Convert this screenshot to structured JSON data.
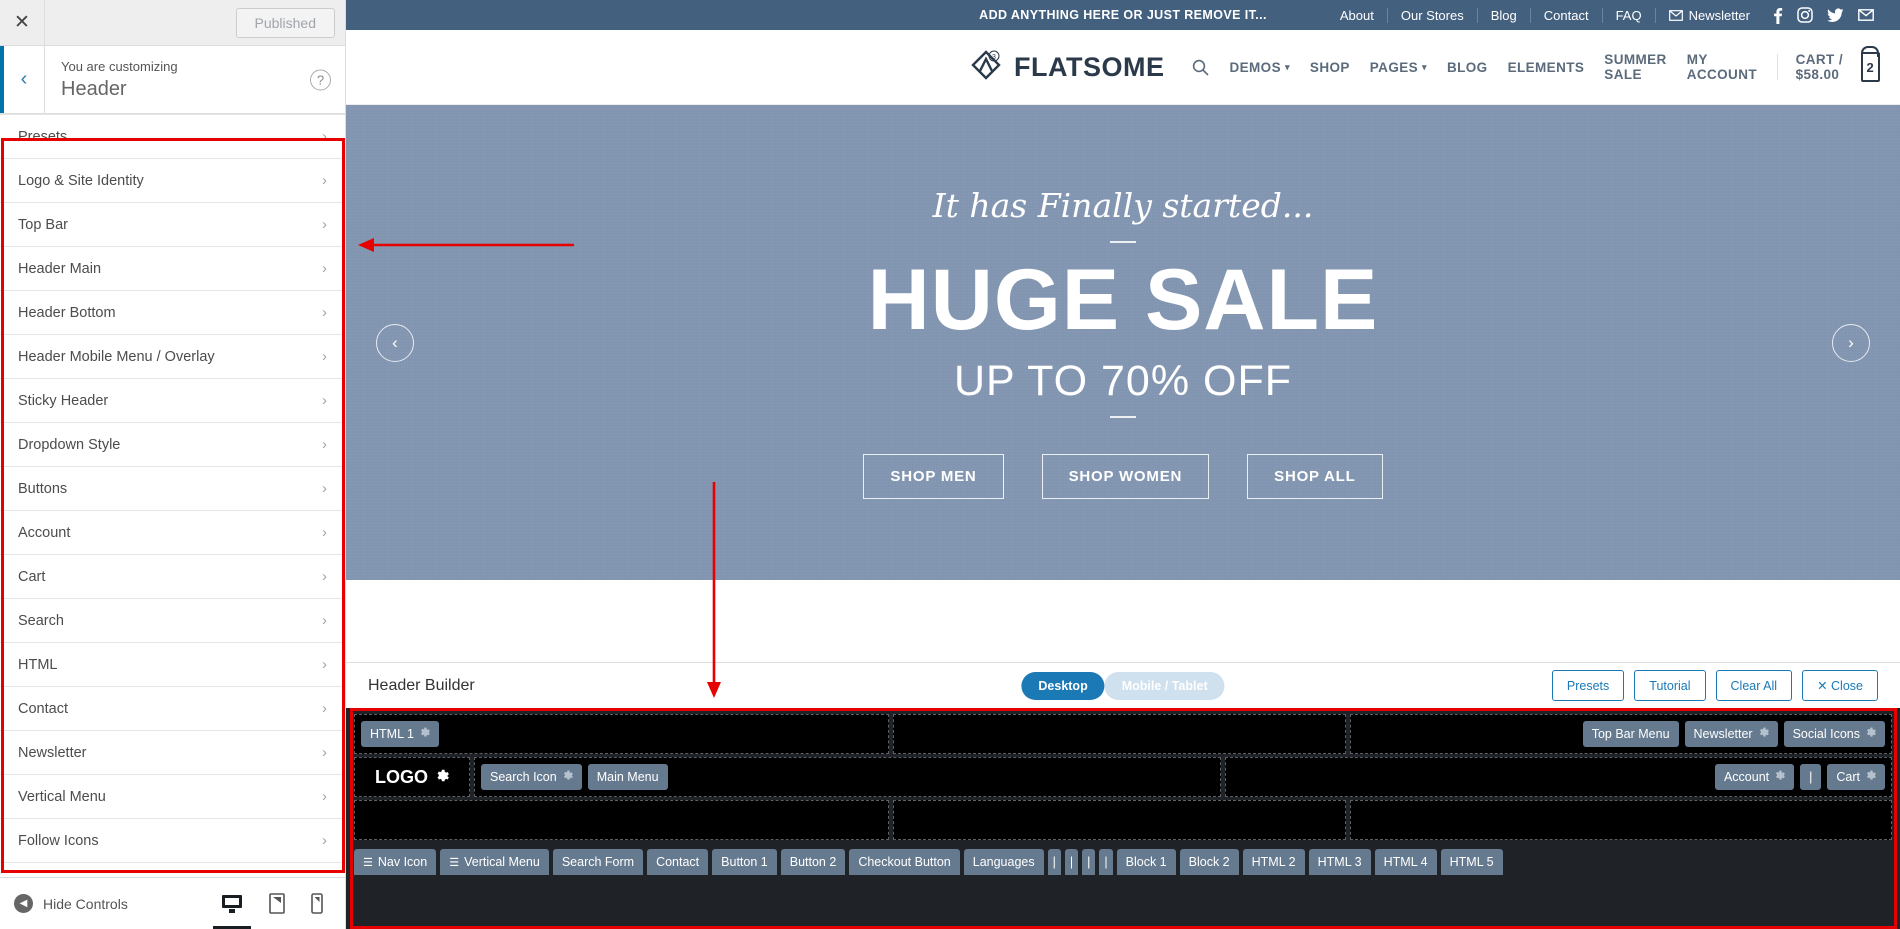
{
  "customizer": {
    "close_icon": "close-icon",
    "publish_label": "Published",
    "back_icon": "chevron-left-icon",
    "you_are_customizing": "You are customizing",
    "panel_title": "Header",
    "help_label": "?",
    "items": [
      {
        "label": "Presets"
      },
      {
        "label": "Logo & Site Identity"
      },
      {
        "label": "Top Bar"
      },
      {
        "label": "Header Main"
      },
      {
        "label": "Header Bottom"
      },
      {
        "label": "Header Mobile Menu / Overlay"
      },
      {
        "label": "Sticky Header"
      },
      {
        "label": "Dropdown Style"
      },
      {
        "label": "Buttons"
      },
      {
        "label": "Account"
      },
      {
        "label": "Cart"
      },
      {
        "label": "Search"
      },
      {
        "label": "HTML"
      },
      {
        "label": "Contact"
      },
      {
        "label": "Newsletter"
      },
      {
        "label": "Vertical Menu"
      },
      {
        "label": "Follow Icons"
      }
    ],
    "footer": {
      "hide_controls": "Hide Controls",
      "devices": [
        "desktop-icon",
        "tablet-icon",
        "mobile-icon"
      ],
      "active_device": "desktop-icon"
    }
  },
  "site": {
    "topbar": {
      "message": "ADD ANYTHING HERE OR JUST REMOVE IT...",
      "links": [
        "About",
        "Our Stores",
        "Blog",
        "Contact",
        "FAQ"
      ],
      "newsletter": "Newsletter",
      "newsletter_icon": "envelope-icon",
      "social": [
        "facebook-icon",
        "instagram-icon",
        "twitter-icon",
        "envelope-icon"
      ],
      "bg_color": "#44607f"
    },
    "header": {
      "logo_text": "FLATSOME",
      "logo_icon": "flatsome-diamond-logo",
      "search_icon": "search-icon",
      "nav": [
        {
          "label": "DEMOS",
          "caret": true
        },
        {
          "label": "SHOP",
          "caret": false
        },
        {
          "label": "PAGES",
          "caret": true
        },
        {
          "label": "BLOG",
          "caret": false
        },
        {
          "label": "ELEMENTS",
          "caret": false
        },
        {
          "label": "SUMMER SALE",
          "caret": false
        }
      ],
      "my_account": "MY ACCOUNT",
      "cart_label": "CART / $58.00",
      "cart_count": "2"
    },
    "hero": {
      "script_line": "It has Finally started...",
      "headline": "HUGE SALE",
      "subheadline": "UP TO 70% OFF",
      "buttons": [
        "SHOP MEN",
        "SHOP WOMEN",
        "SHOP ALL"
      ],
      "prev_icon": "chevron-left-icon",
      "next_icon": "chevron-right-icon",
      "bg_color": "#8295b0"
    }
  },
  "header_builder": {
    "title": "Header Builder",
    "device_toggle": {
      "options": [
        "Desktop",
        "Mobile / Tablet"
      ],
      "selected": "Desktop"
    },
    "actions": [
      "Presets",
      "Tutorial",
      "Clear All"
    ],
    "close_label": "Close",
    "close_icon": "close-icon",
    "rows": [
      {
        "name": "top-bar-row",
        "cells": [
          {
            "align": "left",
            "flex": 1.4,
            "chips": [
              {
                "label": "HTML 1",
                "gear": true
              }
            ]
          },
          {
            "align": "center",
            "flex": 1.18,
            "chips": []
          },
          {
            "align": "right",
            "flex": 1.42,
            "chips": [
              {
                "label": "Top Bar Menu",
                "gear": false
              },
              {
                "label": "Newsletter",
                "gear": true
              },
              {
                "label": "Social Icons",
                "gear": true
              }
            ]
          }
        ]
      },
      {
        "name": "header-main-row",
        "logo": {
          "label": "LOGO",
          "gear": true
        },
        "cells": [
          {
            "align": "left",
            "flex": 1.48,
            "chips": [
              {
                "label": "Search Icon",
                "gear": true
              },
              {
                "label": "Main Menu",
                "gear": false
              }
            ]
          },
          {
            "align": "right",
            "flex": 1.32,
            "chips": [
              {
                "label": "Account",
                "gear": true
              },
              {
                "label": "|",
                "gear": false
              },
              {
                "label": "Cart",
                "gear": true
              }
            ]
          }
        ]
      },
      {
        "name": "header-bottom-row",
        "cells": [
          {
            "align": "left",
            "flex": 1.4,
            "chips": []
          },
          {
            "align": "center",
            "flex": 1.18,
            "chips": []
          },
          {
            "align": "right",
            "flex": 1.42,
            "chips": []
          }
        ]
      }
    ],
    "tray": [
      {
        "label": "Nav Icon",
        "icon": "hamburger-icon"
      },
      {
        "label": "Vertical Menu",
        "icon": "hamburger-icon"
      },
      {
        "label": "Search Form",
        "icon": ""
      },
      {
        "label": "Contact",
        "icon": ""
      },
      {
        "label": "Button 1",
        "icon": ""
      },
      {
        "label": "Button 2",
        "icon": ""
      },
      {
        "label": "Checkout Button",
        "icon": ""
      },
      {
        "label": "Languages",
        "icon": ""
      },
      {
        "label": "|",
        "icon": ""
      },
      {
        "label": "|",
        "icon": ""
      },
      {
        "label": "|",
        "icon": ""
      },
      {
        "label": "|",
        "icon": ""
      },
      {
        "label": "Block 1",
        "icon": ""
      },
      {
        "label": "Block 2",
        "icon": ""
      },
      {
        "label": "HTML 2",
        "icon": ""
      },
      {
        "label": "HTML 3",
        "icon": ""
      },
      {
        "label": "HTML 4",
        "icon": ""
      },
      {
        "label": "HTML 5",
        "icon": ""
      }
    ]
  },
  "annotations": {
    "highlight_color": "#e60000"
  }
}
